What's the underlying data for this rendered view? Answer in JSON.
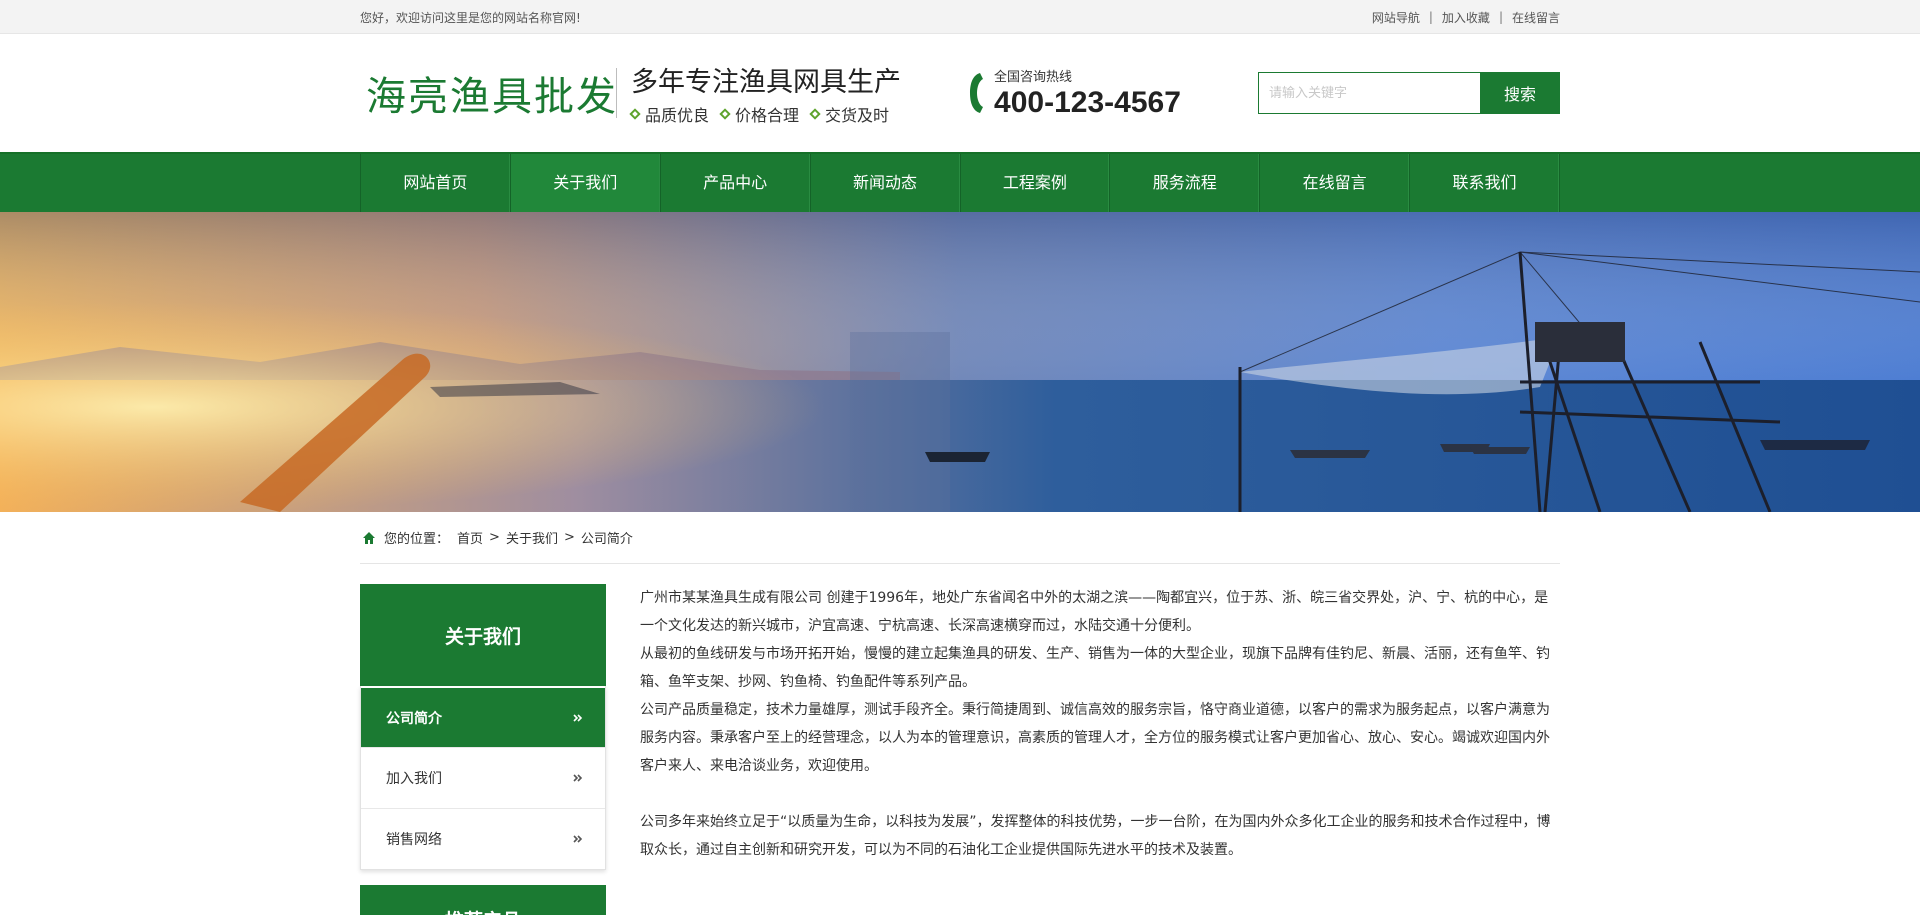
{
  "topbar": {
    "welcome": "您好，欢迎访问这里是您的网站名称官网!",
    "links": [
      "网站导航",
      "加入收藏",
      "在线留言"
    ],
    "separator": "|"
  },
  "header": {
    "brand": "海亮渔具批发",
    "slogan_main": "多年专注渔具网具生产",
    "slogan_tags": [
      "品质优良",
      "价格合理",
      "交货及时"
    ],
    "hotline_label": "全国咨询热线",
    "hotline_number": "400-123-4567",
    "search_placeholder": "请输入关键字",
    "search_button": "搜索"
  },
  "nav": {
    "items": [
      "网站首页",
      "关于我们",
      "产品中心",
      "新闻动态",
      "工程案例",
      "服务流程",
      "在线留言",
      "联系我们"
    ],
    "active_index": 1
  },
  "breadcrumb": {
    "label": "您的位置：",
    "items": [
      "首页",
      "关于我们",
      "公司简介"
    ],
    "separator": ">"
  },
  "sidebar": {
    "title": "关于我们",
    "items": [
      "公司简介",
      "加入我们",
      "销售网络"
    ],
    "active_index": 0,
    "second_title": "推荐产品"
  },
  "article": {
    "paragraphs": [
      "广州市某某渔具生成有限公司 创建于1996年，地处广东省闻名中外的太湖之滨——陶都宜兴，位于苏、浙、皖三省交界处，沪、宁、杭的中心，是一个文化发达的新兴城市，沪宜高速、宁杭高速、长深高速横穿而过，水陆交通十分便利。",
      "从最初的鱼线研发与市场开拓开始，慢慢的建立起集渔具的研发、生产、销售为一体的大型企业，现旗下品牌有佳钓尼、新晨、活丽，还有鱼竿、钓箱、鱼竿支架、抄网、钓鱼椅、钓鱼配件等系列产品。",
      "公司产品质量稳定，技术力量雄厚，测试手段齐全。秉行简捷周到、诚信高效的服务宗旨，恪守商业道德，以客户的需求为服务起点，以客户满意为服务内容。秉承客户至上的经营理念，以人为本的管理意识，高素质的管理人才，全方位的服务模式让客户更加省心、放心、安心。竭诚欢迎国内外客户来人、来电洽谈业务，欢迎使用。",
      "公司多年来始终立足于“以质量为生命，以科技为发展”，发挥整体的科技优势，一步一台阶，在为国内外众多化工企业的服务和技术合作过程中，博取众长，通过自主创新和研究开发，可以为不同的石油化工企业提供国际先进水平的技术及装置。"
    ]
  },
  "colors": {
    "brand_green": "#1b7a32",
    "topbar_bg": "#f3f3f3",
    "accent_diamond": "#5ea32c"
  },
  "icons": [
    "phone-icon",
    "home-icon",
    "double-chevron-right-icon",
    "diamond-bullet-icon"
  ]
}
